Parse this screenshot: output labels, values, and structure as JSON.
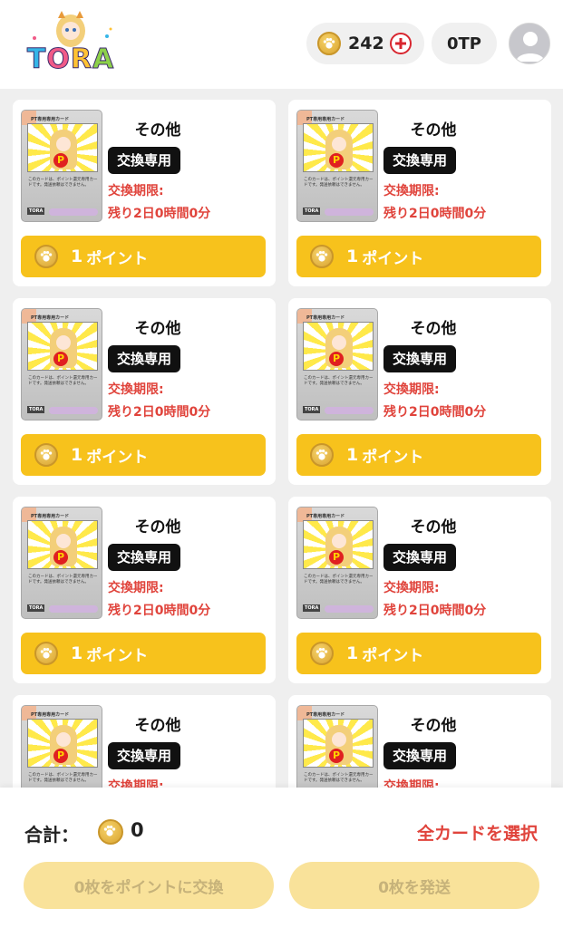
{
  "header": {
    "logo_text": "TORA",
    "coin_balance": "242",
    "tp_balance": "0TP"
  },
  "card_common": {
    "thumb_title": "PT専用専用カード",
    "thumb_text": "このカードは、ポイント還元専用カードです。発送依頼はできません。",
    "thumb_logo": "TORA",
    "p_mark": "P"
  },
  "cards": [
    {
      "category": "その他",
      "badge": "交換専用",
      "deadline_label": "交換期限:",
      "deadline_time": "残り2日0時間0分",
      "points": "1",
      "unit": "ポイント"
    },
    {
      "category": "その他",
      "badge": "交換専用",
      "deadline_label": "交換期限:",
      "deadline_time": "残り2日0時間0分",
      "points": "1",
      "unit": "ポイント"
    },
    {
      "category": "その他",
      "badge": "交換専用",
      "deadline_label": "交換期限:",
      "deadline_time": "残り2日0時間0分",
      "points": "1",
      "unit": "ポイント"
    },
    {
      "category": "その他",
      "badge": "交換専用",
      "deadline_label": "交換期限:",
      "deadline_time": "残り2日0時間0分",
      "points": "1",
      "unit": "ポイント"
    },
    {
      "category": "その他",
      "badge": "交換専用",
      "deadline_label": "交換期限:",
      "deadline_time": "残り2日0時間0分",
      "points": "1",
      "unit": "ポイント"
    },
    {
      "category": "その他",
      "badge": "交換専用",
      "deadline_label": "交換期限:",
      "deadline_time": "残り2日0時間0分",
      "points": "1",
      "unit": "ポイント"
    },
    {
      "category": "その他",
      "badge": "交換専用",
      "deadline_label": "交換期限:",
      "deadline_time": "",
      "points": "",
      "unit": ""
    },
    {
      "category": "その他",
      "badge": "交換専用",
      "deadline_label": "交換期限:",
      "deadline_time": "",
      "points": "",
      "unit": ""
    }
  ],
  "footer": {
    "total_label": "合計：",
    "total_value": "0",
    "select_all": "全カードを選択",
    "exchange_button": "0枚をポイントに交換",
    "send_button": "0枚を発送"
  }
}
